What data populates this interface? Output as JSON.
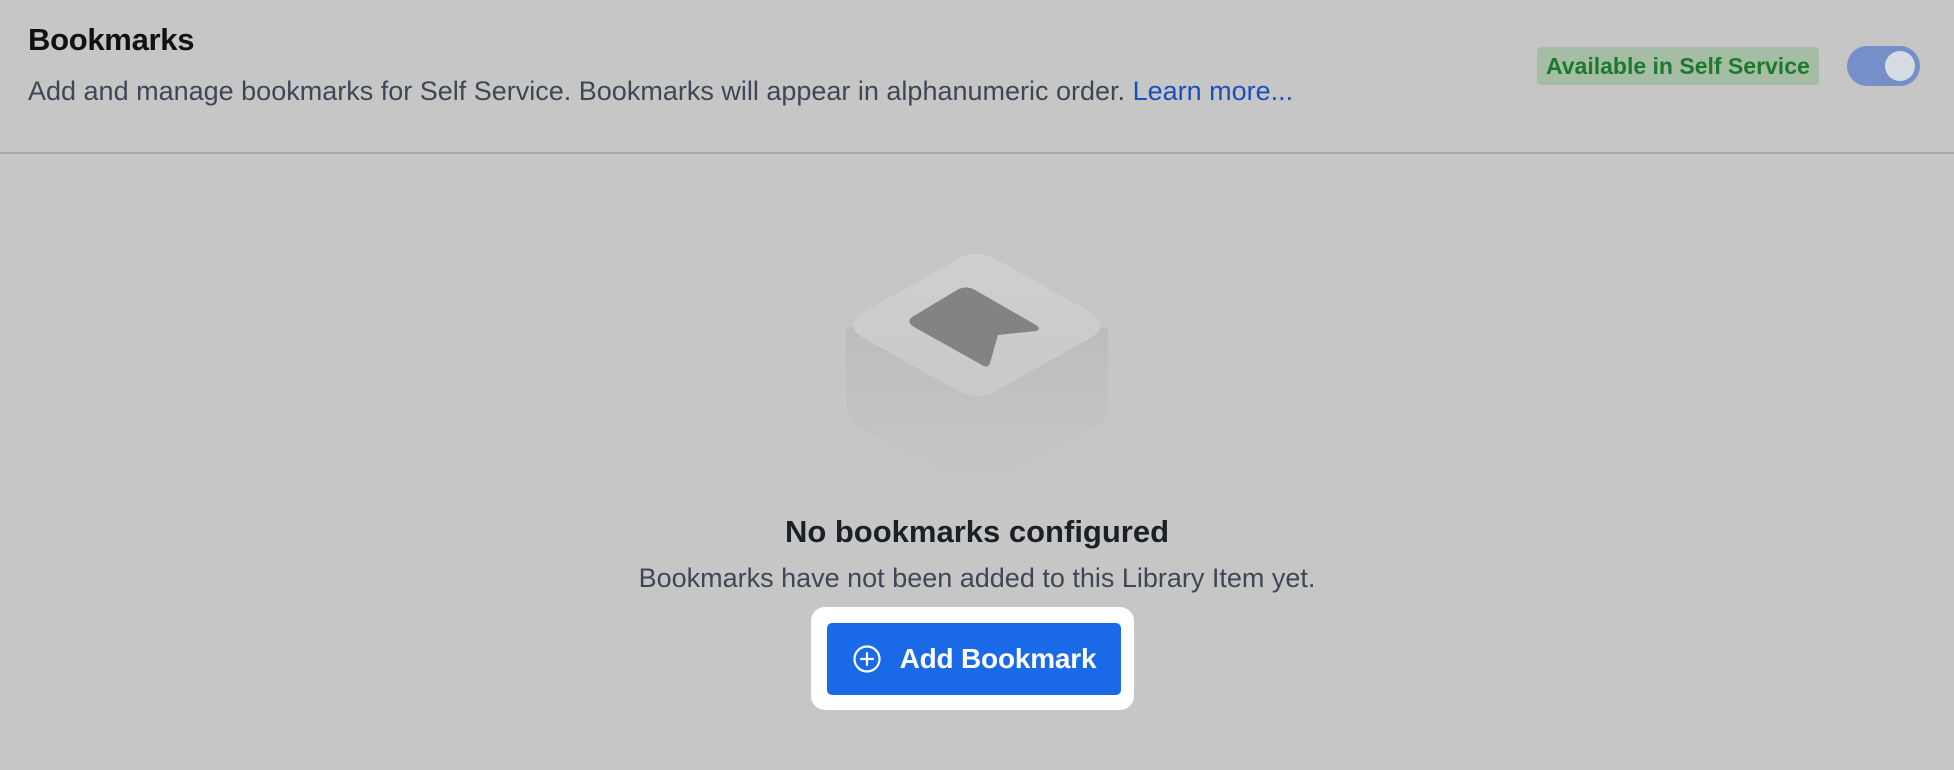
{
  "header": {
    "title": "Bookmarks",
    "description": "Add and manage bookmarks for Self Service. Bookmarks will appear in alphanumeric order.",
    "learn_more_label": "Learn more...",
    "badge_label": "Available in Self Service",
    "toggle_on": true
  },
  "empty_state": {
    "illustration_icon": "bookmark-tray-icon",
    "title": "No bookmarks configured",
    "description": "Bookmarks have not been added to this Library Item yet.",
    "button_icon": "plus-circle-icon",
    "button_label": "Add Bookmark"
  },
  "colors": {
    "background": "#c6c6c6",
    "link": "#1a4fbf",
    "badge_bg": "#a5bca5",
    "badge_text": "#1c7a2c",
    "toggle": "#7590c8",
    "button": "#1a6ae8"
  }
}
